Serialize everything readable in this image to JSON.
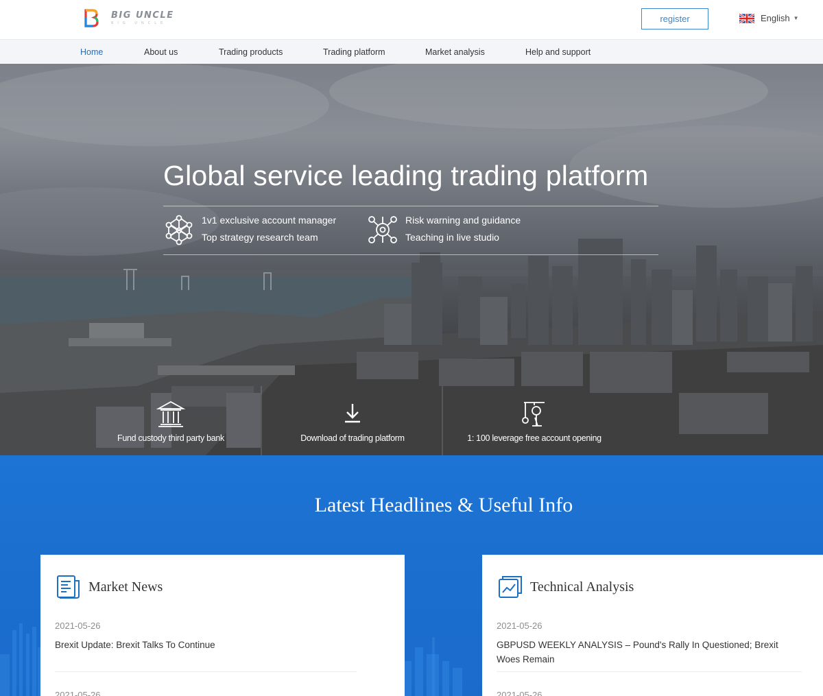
{
  "brand": {
    "name": "BIG UNCLE",
    "sub": "BIG UNCLE"
  },
  "header": {
    "register_label": "register",
    "language": "English"
  },
  "nav": [
    {
      "label": "Home",
      "active": true
    },
    {
      "label": "About us"
    },
    {
      "label": "Trading products"
    },
    {
      "label": "Trading platform"
    },
    {
      "label": "Market analysis"
    },
    {
      "label": "Help and support"
    }
  ],
  "hero": {
    "title": "Global service leading trading platform",
    "features": [
      {
        "icon": "network-icon",
        "lines": [
          "1v1 exclusive account manager",
          "Top strategy research team"
        ]
      },
      {
        "icon": "hub-icon",
        "lines": [
          "Risk warning and guidance",
          "Teaching in live studio"
        ]
      }
    ],
    "bottom_items": [
      {
        "icon": "bank-icon",
        "label": "Fund custody third party bank"
      },
      {
        "icon": "download-icon",
        "label": "Download of trading platform"
      },
      {
        "icon": "leverage-icon",
        "label": "1: 100 leverage free account opening"
      }
    ]
  },
  "headlines": {
    "title": "Latest Headlines & Useful Info",
    "cards": [
      {
        "icon": "news-icon",
        "title": "Market News",
        "date": "2021-05-26",
        "text": "Brexit Update: Brexit Talks To Continue",
        "next_date": "2021-05-26"
      },
      {
        "icon": "chart-icon",
        "title": "Technical Analysis",
        "date": "2021-05-26",
        "text": "GBPUSD WEEKLY ANALYSIS – Pound's Rally In Questioned; Brexit Woes Remain",
        "next_date": "2021-05-26"
      }
    ]
  },
  "colors": {
    "accent": "#1f6fbf",
    "blue_band": "#1b6fcf",
    "register_border": "#3d86c9"
  }
}
